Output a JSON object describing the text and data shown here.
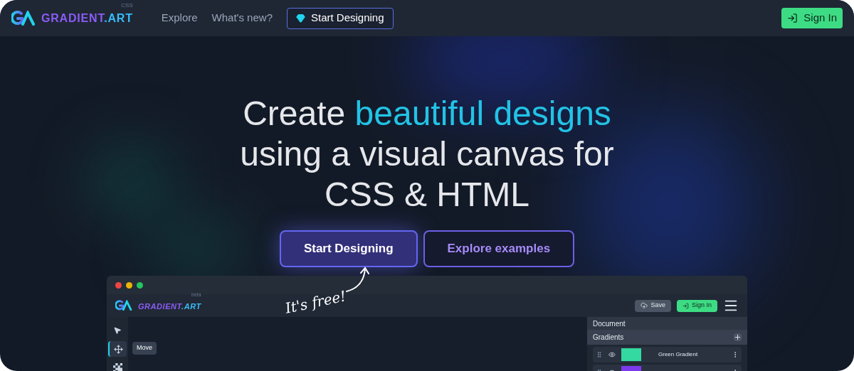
{
  "nav": {
    "logo": {
      "text": "GRADIENT",
      "accent": ".ART",
      "superscript": "CSS"
    },
    "links": [
      "Explore",
      "What's new?"
    ],
    "cta": "Start Designing",
    "sign_in": "Sign In"
  },
  "hero": {
    "headline": {
      "before": "Create ",
      "highlight": "beautiful designs",
      "lines": [
        "using a visual canvas for",
        "CSS & HTML"
      ]
    },
    "buttons": [
      {
        "label": "Start Designing",
        "kind": "primary"
      },
      {
        "label": "Explore examples",
        "kind": "outline"
      }
    ],
    "note": "It's free!"
  },
  "app_preview": {
    "logo": {
      "text": "GRADIENT",
      "accent": ".ART",
      "superscript": "beta"
    },
    "save": "Save",
    "sign_in": "Sign In",
    "tools": [
      {
        "kind": "pointer",
        "selected": false
      },
      {
        "kind": "move",
        "selected": true,
        "tooltip": "Move"
      },
      {
        "kind": "transparency",
        "selected": false
      }
    ],
    "panel": {
      "title": "Document",
      "section": "Gradients",
      "layers": [
        {
          "name": "Green Gradient",
          "color": "#33d9a0"
        },
        {
          "color": "#7c3aed"
        }
      ]
    }
  }
}
